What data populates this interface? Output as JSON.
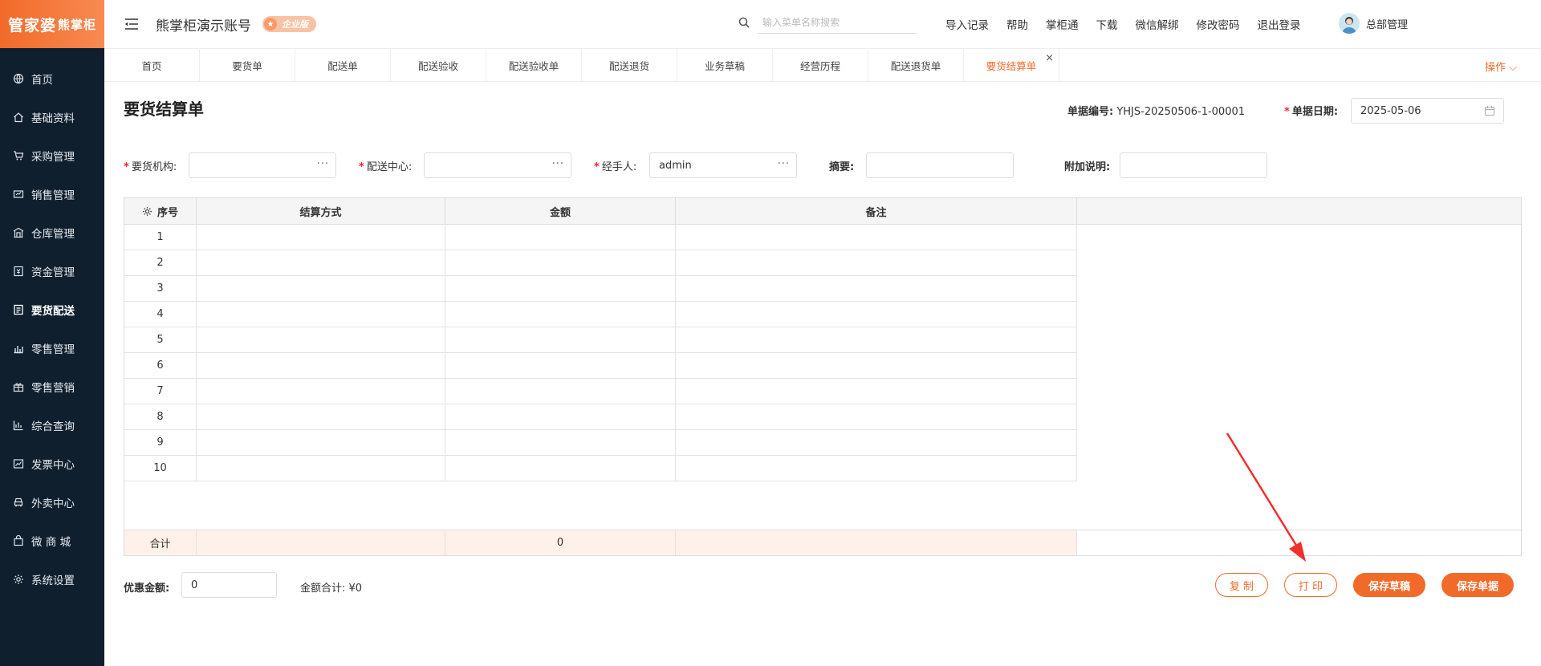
{
  "logo": {
    "main": "管家婆",
    "sub": "熊掌柜"
  },
  "sidebar": {
    "items": [
      {
        "label": "首页",
        "icon": "globe-icon"
      },
      {
        "label": "基础资料",
        "icon": "home-icon"
      },
      {
        "label": "采购管理",
        "icon": "cart-icon"
      },
      {
        "label": "销售管理",
        "icon": "sales-icon"
      },
      {
        "label": "仓库管理",
        "icon": "warehouse-icon"
      },
      {
        "label": "资金管理",
        "icon": "money-icon"
      },
      {
        "label": "要货配送",
        "icon": "document-icon",
        "active": true
      },
      {
        "label": "零售管理",
        "icon": "bar-chart-icon"
      },
      {
        "label": "零售营销",
        "icon": "gift-icon"
      },
      {
        "label": "综合查询",
        "icon": "chart-icon"
      },
      {
        "label": "发票中心",
        "icon": "trend-icon"
      },
      {
        "label": "外卖中心",
        "icon": "delivery-icon"
      },
      {
        "label": "微 商 城",
        "icon": "shop-bag-icon"
      },
      {
        "label": "系统设置",
        "icon": "gear-icon"
      }
    ]
  },
  "header": {
    "account_title": "熊掌柜演示账号",
    "badge": "企业版",
    "search_placeholder": "输入菜单名称搜索",
    "links": [
      "导入记录",
      "帮助",
      "掌柜通",
      "下载",
      "微信解绑",
      "修改密码",
      "退出登录"
    ],
    "user": "总部管理"
  },
  "tabs": {
    "items": [
      "首页",
      "要货单",
      "配送单",
      "配送验收",
      "配送验收单",
      "配送退货",
      "业务草稿",
      "经营历程",
      "配送退货单",
      "要货结算单"
    ],
    "active_index": 9,
    "operations": "操作 ⌵"
  },
  "doc": {
    "title": "要货结算单",
    "no_label": "单据编号:",
    "no_value": "YHJS-20250506-1-00001",
    "date_label": "单据日期:",
    "date_value": "2025-05-06"
  },
  "form": {
    "org_label": "要货机构:",
    "center_label": "配送中心:",
    "handler_label": "经手人:",
    "handler_value": "admin",
    "summary_label": "摘要:",
    "note_label": "附加说明:",
    "dots": "···"
  },
  "table": {
    "headers": [
      "序号",
      "结算方式",
      "金额",
      "备注"
    ],
    "rows": [
      "1",
      "2",
      "3",
      "4",
      "5",
      "6",
      "7",
      "8",
      "9",
      "10"
    ],
    "footer_label": "合计",
    "footer_amount": "0"
  },
  "bottom": {
    "discount_label": "优惠金额:",
    "discount_value": "0",
    "total_label": "金额合计: ¥0",
    "buttons": {
      "copy": "复 制",
      "print": "打 印",
      "save_draft": "保存草稿",
      "save_doc": "保存单据"
    }
  },
  "colors": {
    "accent": "#f26a2a",
    "sidebar_bg": "#0f1f2e",
    "arrow": "#f0302a"
  }
}
